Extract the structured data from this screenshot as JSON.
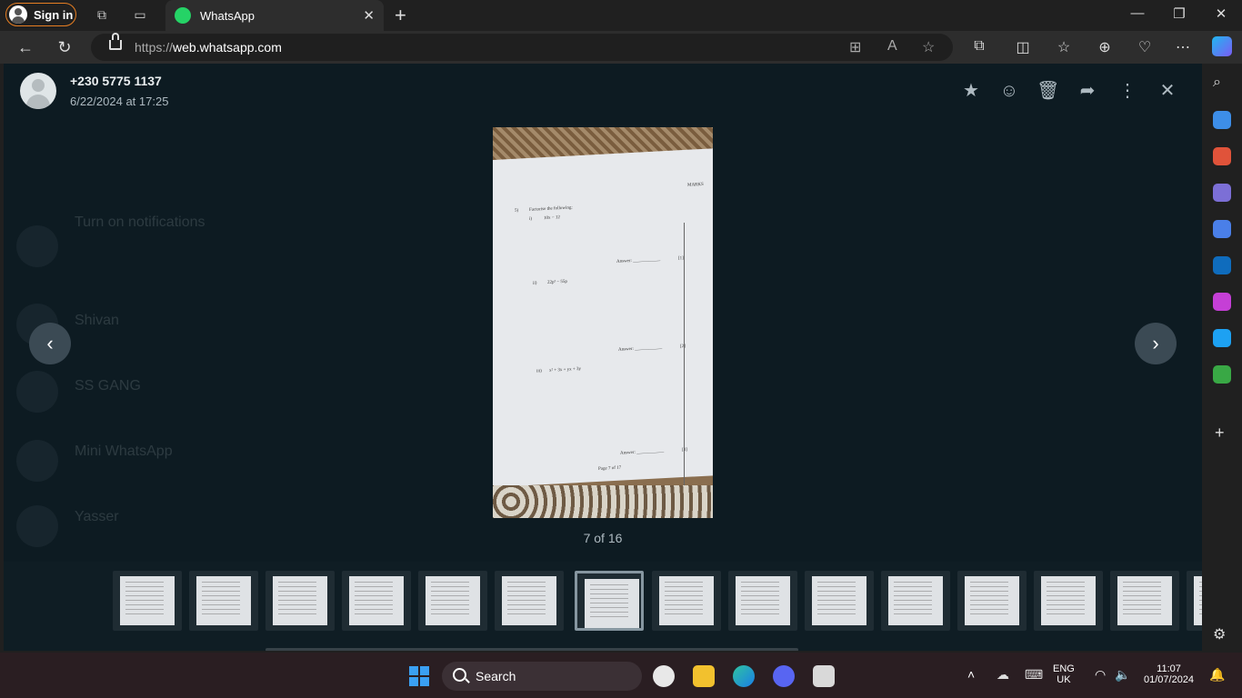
{
  "browser": {
    "signin_label": "Sign in",
    "tab_title": "WhatsApp",
    "url_prefix": "https://",
    "url_host": "web.whatsapp.com",
    "window_controls": {
      "minimize": "—",
      "restore": "❐",
      "close": "✕"
    }
  },
  "viewer": {
    "contact_name": "+230 5775 1137",
    "timestamp": "6/22/2024 at 17:25",
    "counter": "7 of 16",
    "background_chat": {
      "notification_title": "Turn on notifications",
      "chats": [
        "Shivan",
        "SS GANG",
        "Mini WhatsApp",
        "Yasser"
      ]
    },
    "document": {
      "marks_header": "MARKS",
      "question": "Factorise the following:",
      "items": [
        "10x − 12",
        "22p² − 55p",
        "x² + 3x + yx + 3y"
      ],
      "item_numbers": [
        "i)",
        "ii)",
        "iii)"
      ],
      "question_number": "5)",
      "answer_label": "Answer: ____________",
      "answer_marks": [
        "[1]",
        "[2]",
        "[3]"
      ],
      "footer": "Page 7 of 17"
    },
    "thumbnails_count": 15,
    "selected_thumbnail_index": 6
  },
  "taskbar": {
    "search_label": "Search",
    "lang_line1": "ENG",
    "lang_line2": "UK",
    "time": "11:07",
    "date": "01/07/2024"
  }
}
